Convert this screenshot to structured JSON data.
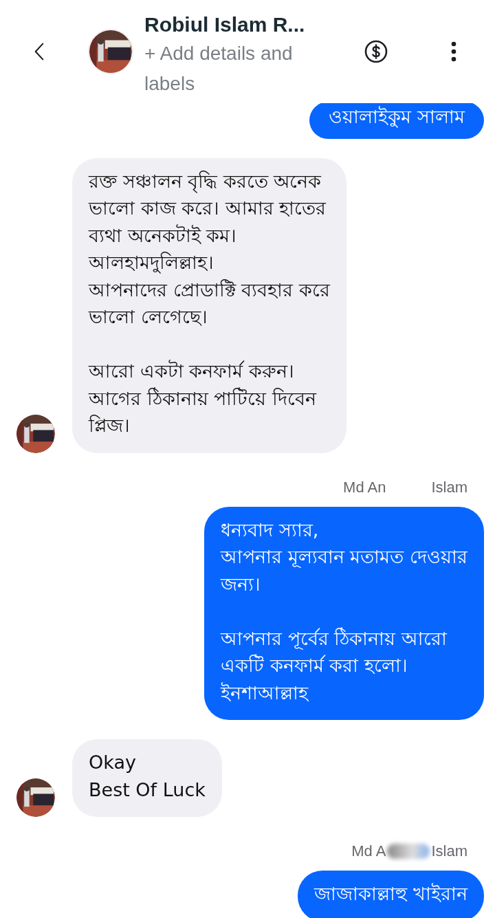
{
  "header": {
    "name": "Robiul Islam R...",
    "subtitle": "+ Add details and labels"
  },
  "messages": [
    {
      "kind": "outgoing",
      "text": "ওয়ালাইকুম সালাম"
    },
    {
      "kind": "incoming",
      "text": "রক্ত সঞ্চালন বৃদ্ধি করতে অনেক\nভালো কাজ করে। আমার হাতের\nব্যথা অনেকটাই কম।\nআলহামদুলিল্লাহ।\nআপনাদের প্রোডাক্টি ব্যবহার করে\nভালো লেগেছে।\n\nআরো একটা কনফার্ম করুন।\nআগের ঠিকানায় পাটিয়ে দিবেন\nপ্লিজ।"
    },
    {
      "kind": "sender",
      "first": "Md An",
      "last": "Islam",
      "blurred": false
    },
    {
      "kind": "outgoing",
      "text": "ধন্যবাদ স্যার,\nআপনার মূল্যবান মতামত দেওয়ার\nজন্য।\n\nআপনার পূর্বের ঠিকানায় আরো\nএকটি কনফার্ম করা হলো।\nইনশাআল্লাহ"
    },
    {
      "kind": "incoming",
      "text": "Okay\nBest Of Luck"
    },
    {
      "kind": "sender",
      "first": "Md A",
      "last": "Islam",
      "blurred": true
    },
    {
      "kind": "outgoing",
      "text": "জাজাকাল্লাহু খাইরান"
    }
  ]
}
